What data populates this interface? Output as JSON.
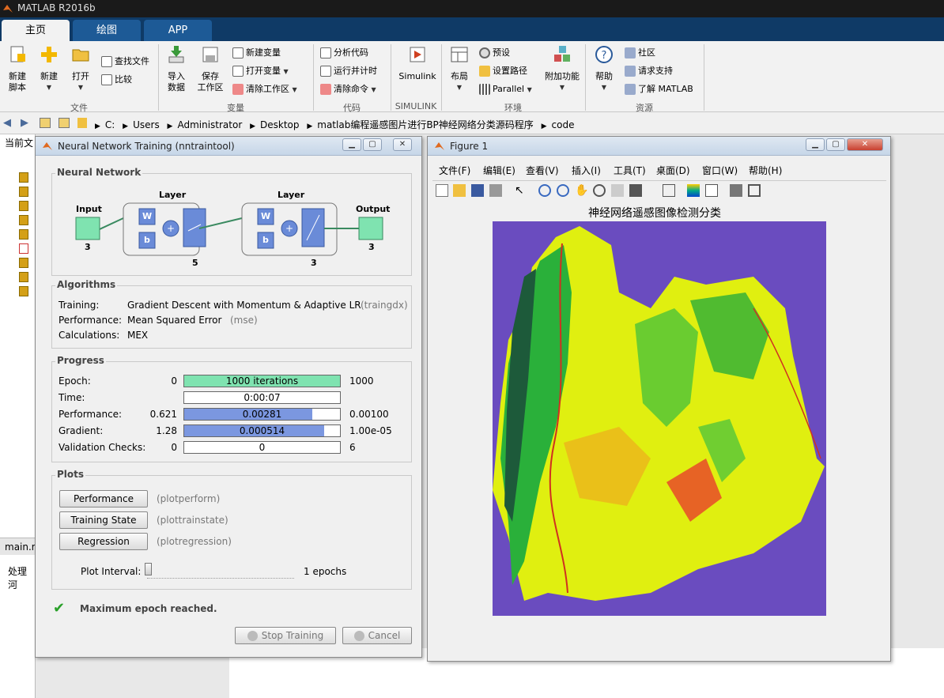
{
  "app": {
    "title": "MATLAB R2016b"
  },
  "tabs": [
    {
      "label": "主页"
    },
    {
      "label": "绘图"
    },
    {
      "label": "APP"
    }
  ],
  "ribbon": {
    "file": {
      "new_script": "新建\n脚本",
      "new": "新建",
      "open": "打开",
      "find_files": "查找文件",
      "compare": "比较",
      "group": "文件"
    },
    "variable": {
      "import": "导入\n数据",
      "save_ws": "保存\n工作区",
      "new_var": "新建变量",
      "open_var": "打开变量",
      "clear_ws": "清除工作区",
      "group": "变量"
    },
    "code": {
      "analyze": "分析代码",
      "run_time": "运行并计时",
      "clear_cmd": "清除命令",
      "group": "代码"
    },
    "simulink": {
      "label": "Simulink",
      "group": "SIMULINK"
    },
    "env": {
      "layout": "布局",
      "prefs": "预设",
      "set_path": "设置路径",
      "parallel": "Parallel",
      "addons": "附加功能",
      "group": "环境"
    },
    "resources": {
      "help": "帮助",
      "community": "社区",
      "request_support": "请求支持",
      "learn": "了解 MATLAB",
      "group": "资源"
    }
  },
  "address": {
    "crumbs": [
      "C:",
      "Users",
      "Administrator",
      "Desktop",
      "matlab编程遥感图片进行BP神经网络分类源码程序",
      "code"
    ]
  },
  "left": {
    "header": "当前文",
    "tab2": "main.m",
    "process": "处理河"
  },
  "nn": {
    "title": "Neural Network Training (nntraintool)",
    "network_title": "Neural Network",
    "input_label": "Input",
    "input_n": "3",
    "layer1_label": "Layer",
    "layer1_n": "5",
    "layer2_label": "Layer",
    "layer2_n": "3",
    "output_label": "Output",
    "output_n": "3",
    "w": "W",
    "b": "b",
    "algorithms_title": "Algorithms",
    "training_label": "Training:",
    "training_val": "Gradient Descent with Momentum & Adaptive LR",
    "training_fn": "(traingdx)",
    "perf_label": "Performance:",
    "perf_val": "Mean Squared Error",
    "perf_fn": "(mse)",
    "calc_label": "Calculations:",
    "calc_val": "MEX",
    "progress_title": "Progress",
    "rows": [
      {
        "label": "Epoch:",
        "start": "0",
        "text": "1000 iterations",
        "end": "1000",
        "fill": 1.0,
        "color": "#7fe3b0"
      },
      {
        "label": "Time:",
        "start": "",
        "text": "0:00:07",
        "end": "",
        "fill": 0,
        "color": "#8aa5e8"
      },
      {
        "label": "Performance:",
        "start": "0.621",
        "text": "0.00281",
        "end": "0.00100",
        "fill": 0.82,
        "color": "#7b97e0"
      },
      {
        "label": "Gradient:",
        "start": "1.28",
        "text": "0.000514",
        "end": "1.00e-05",
        "fill": 0.9,
        "color": "#7b97e0"
      },
      {
        "label": "Validation Checks:",
        "start": "0",
        "text": "0",
        "end": "6",
        "fill": 0,
        "color": "#7b97e0"
      }
    ],
    "plots_title": "Plots",
    "plots": [
      {
        "label": "Performance",
        "fn": "(plotperform)"
      },
      {
        "label": "Training State",
        "fn": "(plottrainstate)"
      },
      {
        "label": "Regression",
        "fn": "(plotregression)"
      }
    ],
    "interval_label": "Plot Interval:",
    "interval_val": "1 epochs",
    "status": "Maximum epoch reached.",
    "stop": "Stop Training",
    "cancel": "Cancel"
  },
  "figure": {
    "title": "Figure 1",
    "menus": [
      "文件(F)",
      "编辑(E)",
      "查看(V)",
      "插入(I)",
      "工具(T)",
      "桌面(D)",
      "窗口(W)",
      "帮助(H)"
    ],
    "plot_title": "神经网络遥感图像检测分类"
  },
  "colors": {
    "accent": "#0f3a66",
    "map_bg": "#6a4cbf",
    "map_green": "#3dc03d",
    "map_yellow": "#f0f000",
    "map_red": "#d93020"
  }
}
